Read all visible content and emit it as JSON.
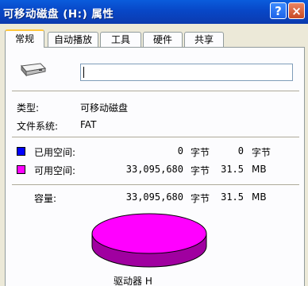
{
  "window": {
    "title": "可移动磁盘 (H:) 属性",
    "help_button": "?",
    "close_button": "×"
  },
  "tabs": [
    {
      "label": "常规",
      "active": true
    },
    {
      "label": "自动播放",
      "active": false
    },
    {
      "label": "工具",
      "active": false
    },
    {
      "label": "硬件",
      "active": false
    },
    {
      "label": "共享",
      "active": false
    }
  ],
  "general": {
    "drive_icon": "removable-drive-icon",
    "name_value": "",
    "type_label": "类型:",
    "type_value": "可移动磁盘",
    "fs_label": "文件系统:",
    "fs_value": "FAT",
    "used": {
      "label": "已用空间:",
      "bytes": "0",
      "bytes_unit": "字节",
      "size": "0",
      "size_unit": "字节",
      "color": "#0000ff"
    },
    "free": {
      "label": "可用空间:",
      "bytes": "33,095,680",
      "bytes_unit": "字节",
      "size": "31.5",
      "size_unit": "MB",
      "color": "#ff00ff"
    },
    "capacity": {
      "label": "容量:",
      "bytes": "33,095,680",
      "bytes_unit": "字节",
      "size": "31.5",
      "size_unit": "MB"
    },
    "pie_label": "驱动器 H"
  }
}
